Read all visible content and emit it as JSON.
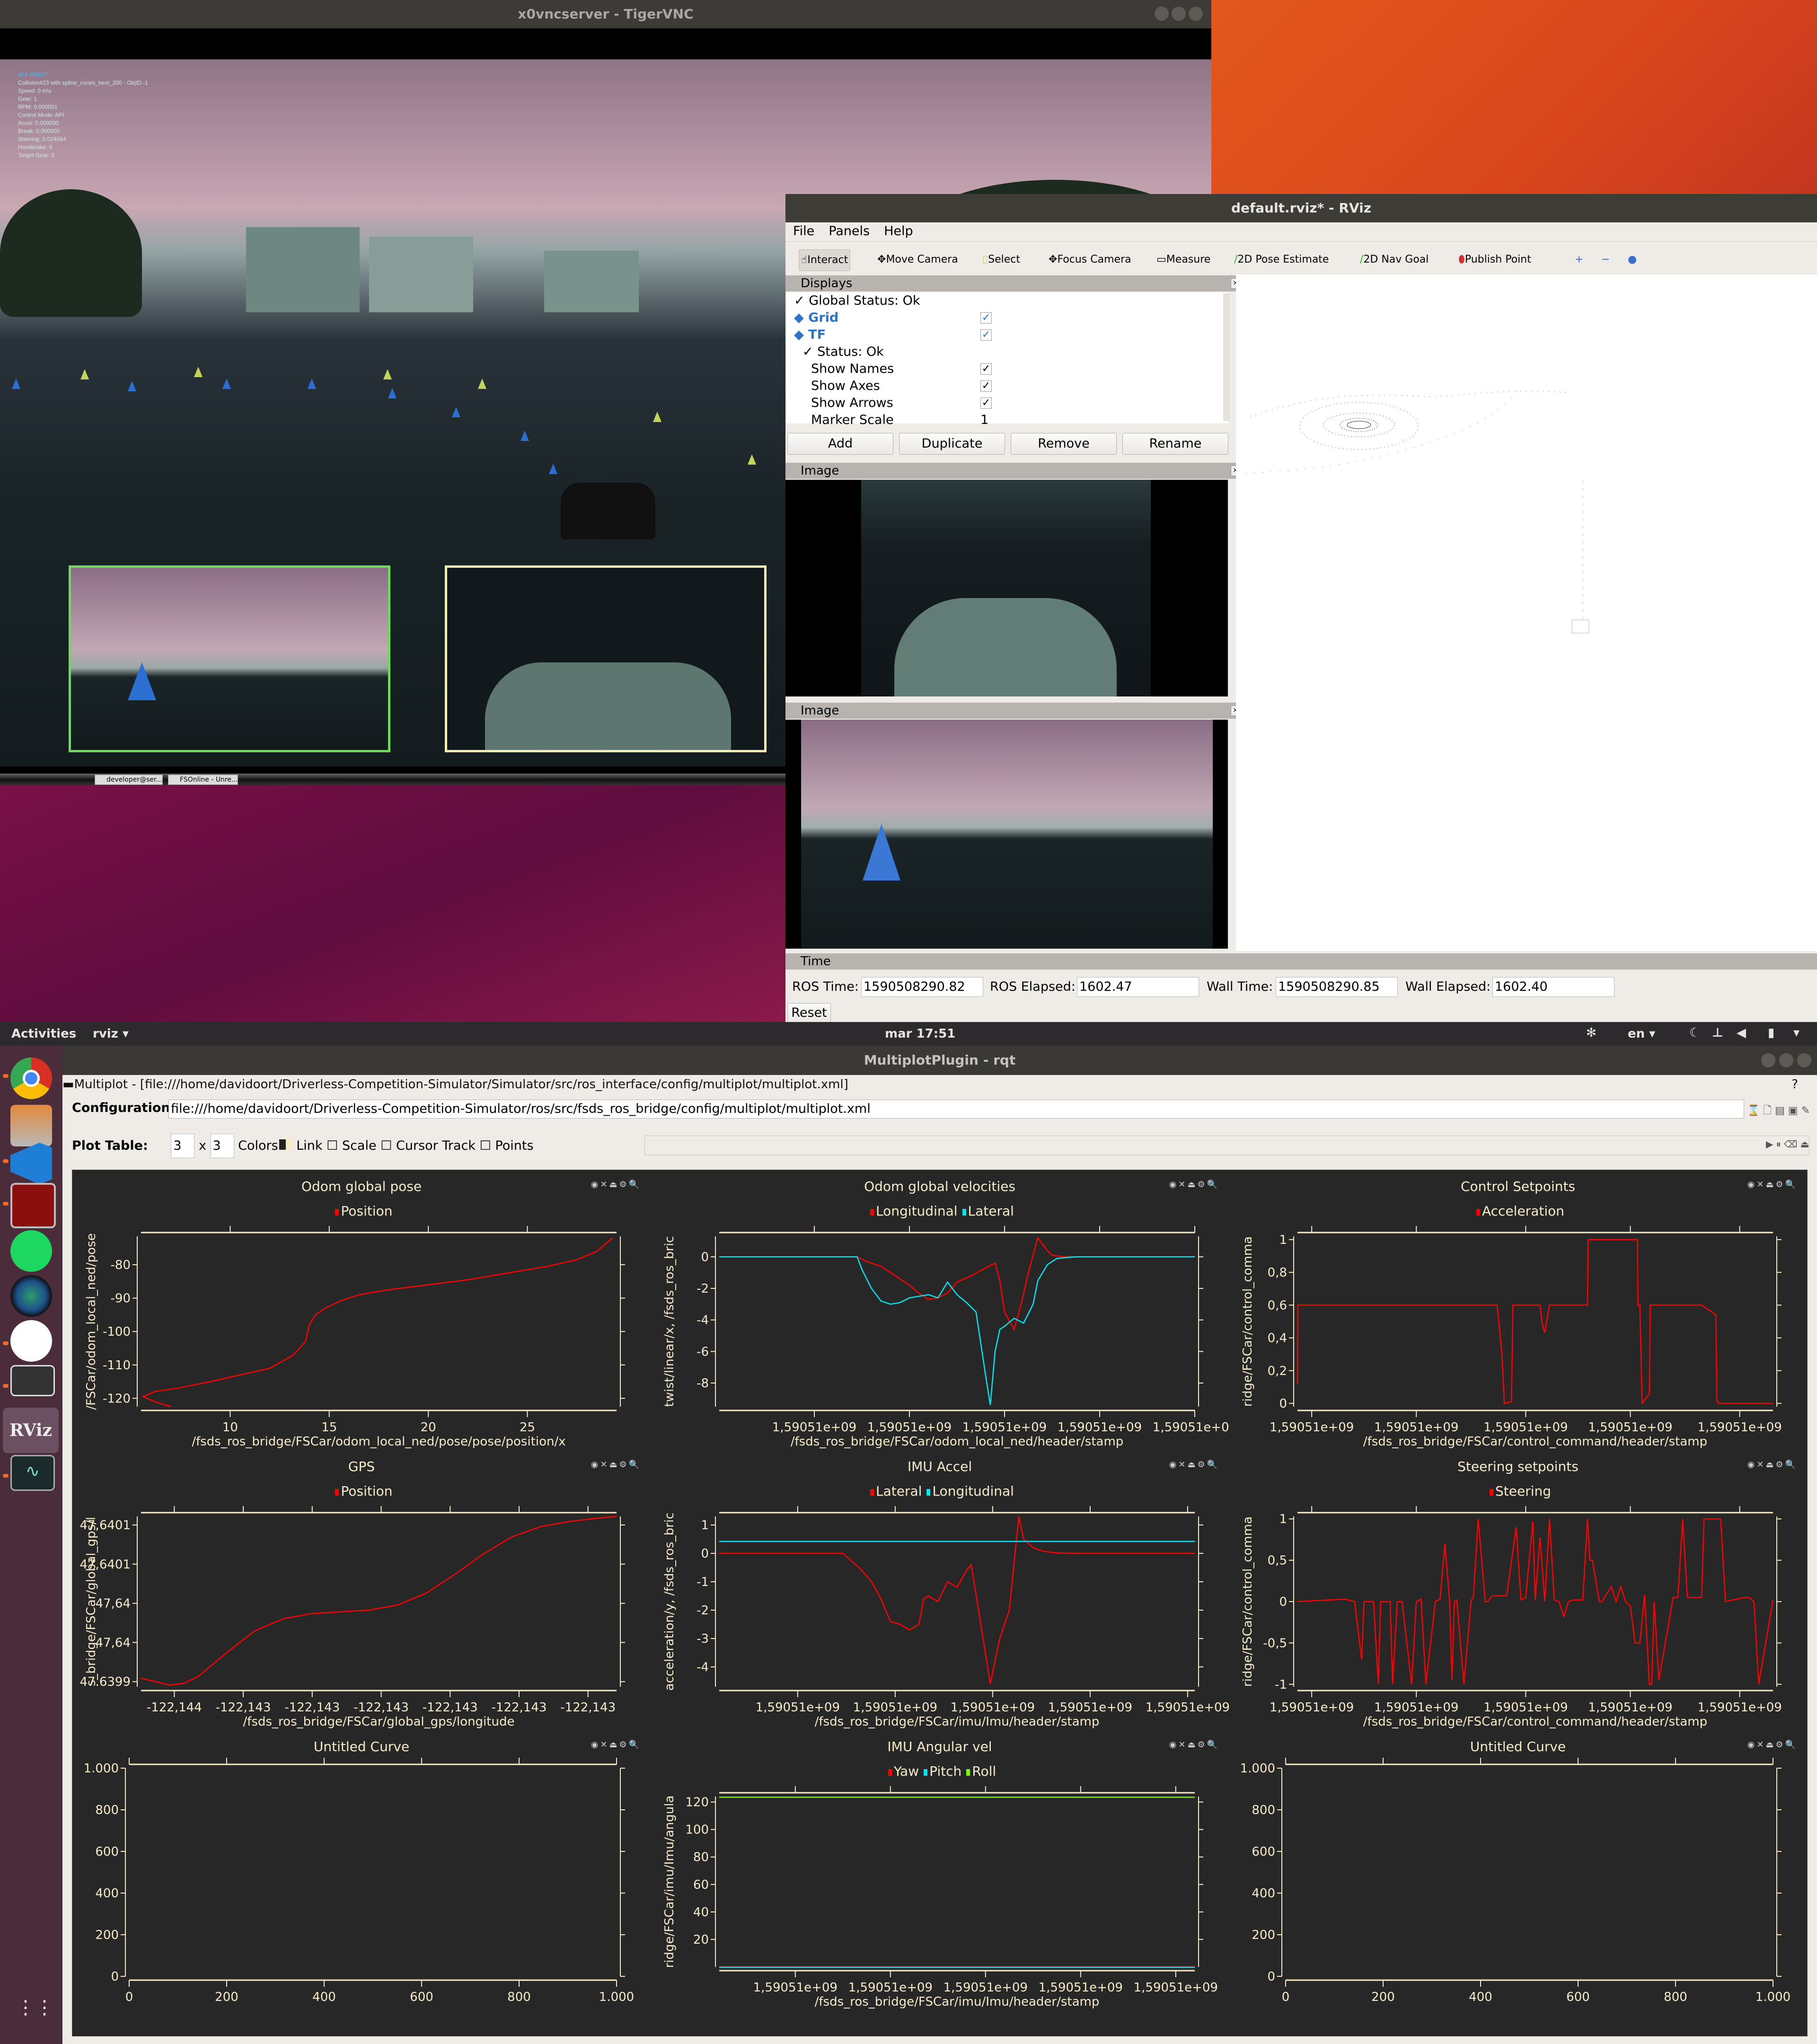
{
  "vnc": {
    "title": "x0vncserver - TigerVNC",
    "hud": [
      "424.485077",
      "Collision#23 with spline_cones_best_200 - ObjID -1",
      "Speed: 0 m\\s",
      "Gear: 1",
      "RPM: 0.000001",
      "Control Mode: API",
      "Accel: 0.000000",
      "Break: 0.000000",
      "Steering: 0.024564",
      "Handbrake: 0",
      "Target Gear: 0"
    ],
    "taskbar": [
      "developer@ser...",
      "FSOnline - Unre..."
    ]
  },
  "rviz": {
    "title": "default.rviz* - RViz",
    "menu": [
      "File",
      "Panels",
      "Help"
    ],
    "tools": [
      "Interact",
      "Move Camera",
      "Select",
      "Focus Camera",
      "Measure",
      "2D Pose Estimate",
      "2D Nav Goal",
      "Publish Point"
    ],
    "tool_icons": [
      "hand-icon",
      "move-camera-icon",
      "select-icon",
      "focus-camera-icon",
      "measure-icon",
      "pose-estimate-icon",
      "nav-goal-icon",
      "publish-point-icon"
    ],
    "displays_title": "Displays",
    "displays": [
      {
        "label": "Global Status: Ok",
        "checked": null,
        "indent": 0,
        "blue": false
      },
      {
        "label": "Grid",
        "checked": true,
        "indent": 0,
        "blue": true
      },
      {
        "label": "TF",
        "checked": true,
        "indent": 0,
        "blue": true
      },
      {
        "label": "Status: Ok",
        "checked": null,
        "indent": 1,
        "blue": false
      },
      {
        "label": "Show Names",
        "checked": true,
        "indent": 2,
        "blue": false
      },
      {
        "label": "Show Axes",
        "checked": true,
        "indent": 2,
        "blue": false
      },
      {
        "label": "Show Arrows",
        "checked": true,
        "indent": 2,
        "blue": false
      },
      {
        "label": "Marker Scale",
        "value": "1",
        "indent": 2,
        "blue": false
      }
    ],
    "buttons": [
      "Add",
      "Duplicate",
      "Remove",
      "Rename"
    ],
    "image_panel_1": "Image",
    "image_panel_2": "Image",
    "time_panel": "Time",
    "time": {
      "ros_time_label": "ROS Time:",
      "ros_time": "1590508290.82",
      "ros_elapsed_label": "ROS Elapsed:",
      "ros_elapsed": "1602.47",
      "wall_time_label": "Wall Time:",
      "wall_time": "1590508290.85",
      "wall_elapsed_label": "Wall Elapsed:",
      "wall_elapsed": "1602.40",
      "reset": "Reset"
    }
  },
  "topbar": {
    "activities": "Activities",
    "app": "rviz",
    "clock": "mar 17:51",
    "lang": "en"
  },
  "dock": [
    "chrome",
    "files",
    "vscode",
    "terminator",
    "spotify",
    "camera",
    "slack",
    "no-entry-app",
    "rviz",
    "system-monitor"
  ],
  "rqt": {
    "title": "MultiplotPlugin - rqt",
    "header": "Multiplot - [file:///home/davidoort/Driverless-Competition-Simulator/Simulator/src/ros_interface/config/multiplot/multiplot.xml]",
    "config_label": "Configuration:",
    "config_value": "file:///home/davidoort/Driverless-Competition-Simulator/ros/src/fsds_ros_bridge/config/multiplot/multiplot.xml",
    "plot_table_label": "Plot Table:",
    "rows": "3",
    "cols": "3",
    "x_sep": "x",
    "options": [
      "Colors",
      "Link",
      "Scale",
      "Cursor",
      "Track",
      "Points"
    ]
  },
  "chart_data": [
    {
      "type": "line",
      "title": "Odom global pose",
      "legend": [
        "Position"
      ],
      "colors": [
        "#ff0000"
      ],
      "xlabel": "/fsds_ros_bridge/FSCar/odom_local_ned/pose/pose/position/x",
      "ylabel": "/FSCar/odom_local_ned/pose",
      "xlim": [
        5.5,
        29.5
      ],
      "ylim": [
        -122.5,
        -71.5
      ],
      "xticks": [
        "10",
        "15",
        "20",
        "25"
      ],
      "xtickvals": [
        10,
        15,
        20,
        25
      ],
      "yticks": [
        "-80",
        "-90",
        "-100",
        "-110",
        "-120"
      ],
      "ytickvals": [
        -80,
        -90,
        -100,
        -110,
        -120
      ],
      "series": [
        {
          "name": "Position",
          "x": [
            7,
            6.2,
            5.6,
            6.2,
            7.5,
            9,
            10.5,
            12,
            13.2,
            13.8,
            14,
            14.3,
            14.8,
            15.5,
            16.5,
            18,
            20,
            22,
            24,
            26,
            27.5,
            28.5,
            29.3
          ],
          "y": [
            -122.5,
            -121,
            -119.5,
            -118,
            -116.8,
            -115,
            -113,
            -111,
            -107,
            -103,
            -98,
            -95,
            -93,
            -91,
            -89,
            -87.5,
            -86,
            -84.5,
            -82.5,
            -80.5,
            -78.5,
            -76,
            -72
          ]
        }
      ]
    },
    {
      "type": "line",
      "title": "Odom global velocities",
      "legend": [
        "Longitudinal",
        "Lateral"
      ],
      "colors": [
        "#ff0000",
        "#00e5f0"
      ],
      "xlabel": "/fsds_ros_bridge/FSCar/odom_local_ned/header/stamp",
      "ylabel": "twist/linear/x, /fsds_ros_bric",
      "xlim": [
        0,
        100
      ],
      "ylim": [
        -9.5,
        1.3
      ],
      "xticks": [
        "1,59051e+09",
        "1,59051e+09",
        "1,59051e+09",
        "1,59051e+09",
        "1,59051e+09"
      ],
      "xtickvals": [
        20,
        40,
        60,
        80,
        100
      ],
      "yticks": [
        "0",
        "-2",
        "-4",
        "-6",
        "-8"
      ],
      "ytickvals": [
        0,
        -2,
        -4,
        -6,
        -8
      ],
      "series": [
        {
          "name": "Longitudinal",
          "x": [
            0,
            29,
            31,
            34,
            37,
            40,
            42,
            44,
            46,
            48,
            50,
            53,
            56,
            58,
            59,
            60,
            62,
            63.5,
            65,
            67,
            69,
            70,
            72,
            75,
            76
          ],
          "y": [
            0,
            0,
            -0.3,
            -0.6,
            -1.2,
            -1.8,
            -2.3,
            -2.7,
            -2.6,
            -2.3,
            -1.6,
            -1.2,
            -0.7,
            -0.4,
            -1.5,
            -3.5,
            -4.6,
            -3,
            -1,
            1.2,
            0.4,
            0.1,
            0.02,
            0,
            0
          ]
        },
        {
          "name": "Lateral",
          "x": [
            0,
            29,
            30,
            32,
            34,
            36,
            38,
            40,
            42,
            44,
            46,
            48,
            50,
            52,
            54,
            56,
            57,
            58,
            59,
            60,
            62,
            64,
            66,
            67,
            69,
            71,
            74,
            76,
            100
          ],
          "y": [
            0,
            0,
            -0.8,
            -2,
            -2.8,
            -3,
            -2.9,
            -2.6,
            -2.5,
            -2.4,
            -2.6,
            -1.6,
            -2.4,
            -2.9,
            -3.5,
            -7.5,
            -9.4,
            -6,
            -4.6,
            -4.4,
            -3.9,
            -4.2,
            -3,
            -1.5,
            -0.5,
            -0.1,
            -0.02,
            0,
            0
          ]
        }
      ]
    },
    {
      "type": "line",
      "title": "Control Setpoints",
      "legend": [
        "Acceleration"
      ],
      "colors": [
        "#ff0000"
      ],
      "xlabel": "/fsds_ros_bridge/FSCar/control_command/header/stamp",
      "ylabel": "ridge/FSCar/control_comma",
      "xlim": [
        0,
        100
      ],
      "ylim": [
        -0.02,
        1.02
      ],
      "xticks": [
        "1,59051e+09",
        "1,59051e+09",
        "1,59051e+09",
        "1,59051e+09",
        "1,59051e+09"
      ],
      "xtickvals": [
        3,
        25,
        48,
        70,
        93
      ],
      "yticks": [
        "1",
        "0,8",
        "0,6",
        "0,4",
        "0,2",
        "0"
      ],
      "ytickvals": [
        1,
        0.8,
        0.6,
        0.4,
        0.2,
        0
      ],
      "series": [
        {
          "name": "Acceleration",
          "x": [
            0,
            0.1,
            42,
            43,
            43.5,
            45,
            45.3,
            51,
            51.5,
            52,
            53,
            61,
            61.1,
            71.5,
            71.6,
            72,
            72.5,
            74,
            74.2,
            85,
            88,
            88.2,
            88.5,
            100
          ],
          "y": [
            0.12,
            0.6,
            0.6,
            0.3,
            0,
            0.01,
            0.6,
            0.6,
            0.48,
            0.43,
            0.6,
            0.6,
            1,
            1,
            0.6,
            0.6,
            0,
            0.06,
            0.6,
            0.6,
            0.54,
            0.02,
            0,
            0
          ]
        }
      ]
    },
    {
      "type": "line",
      "title": "GPS",
      "legend": [
        "Position"
      ],
      "colors": [
        "#ff0000"
      ],
      "xlabel": "/fsds_ros_bridge/FSCar/global_gps/longitude",
      "ylabel": "s_bridge/FSCar/global_gps/l",
      "xlim": [
        0,
        100
      ],
      "ylim": [
        0,
        100
      ],
      "xticks": [
        "-122,144",
        "-122,143",
        "-122,143",
        "-122,143",
        "-122,143",
        "-122,143",
        "-122,143"
      ],
      "xtickvals": [
        7,
        21.5,
        36,
        50.5,
        65,
        79.5,
        94
      ],
      "yticks": [
        "47,6401",
        "47,6401",
        "47,64",
        "47,64",
        "47.6399"
      ],
      "ytickvals": [
        95,
        72,
        49,
        26,
        3
      ],
      "series": [
        {
          "name": "Position",
          "x": [
            0,
            3,
            6,
            9,
            12,
            18,
            24,
            30,
            36,
            42,
            48,
            54,
            60,
            66,
            72,
            78,
            84,
            90,
            96,
            100
          ],
          "y": [
            5,
            3,
            1,
            2,
            6,
            20,
            33,
            40,
            43,
            44,
            45,
            48,
            55,
            66,
            78,
            88,
            94,
            97,
            99,
            100
          ]
        }
      ]
    },
    {
      "type": "line",
      "title": "IMU Accel",
      "legend": [
        "Lateral",
        "Longitudinal"
      ],
      "colors": [
        "#ff0000",
        "#00e5f0"
      ],
      "xlabel": "/fsds_ros_bridge/FSCar/imu/Imu/header/stamp",
      "ylabel": "acceleration/y, /fsds_ros_bric",
      "xlim": [
        0,
        100
      ],
      "ylim": [
        -4.7,
        1.3
      ],
      "xticks": [
        "1,59051e+09",
        "1,59051e+09",
        "1,59051e+09",
        "1,59051e+09",
        "1,59051e+09"
      ],
      "xtickvals": [
        16.5,
        37,
        57.5,
        78,
        98.5
      ],
      "yticks": [
        "1",
        "0",
        "-1",
        "-2",
        "-3",
        "-4"
      ],
      "ytickvals": [
        1,
        0,
        -1,
        -2,
        -3,
        -4
      ],
      "series": [
        {
          "name": "Lateral",
          "x": [
            0,
            26,
            28,
            30,
            32,
            34,
            36,
            38,
            40,
            42,
            43,
            44,
            46,
            48,
            50,
            52,
            53,
            55,
            57,
            59,
            61,
            63,
            64,
            66,
            68,
            70,
            72,
            75,
            100
          ],
          "y": [
            0,
            0,
            -0.3,
            -0.6,
            -1,
            -1.6,
            -2.4,
            -2.5,
            -2.7,
            -2.5,
            -1.6,
            -1.5,
            -1.7,
            -1,
            -1.2,
            -0.6,
            -0.4,
            -2.5,
            -4.6,
            -3,
            -2,
            1.3,
            0.5,
            0.2,
            0.08,
            0.03,
            0.01,
            0,
            0
          ]
        },
        {
          "name": "Longitudinal",
          "x": [
            0,
            100
          ],
          "y": [
            0.42,
            0.42
          ]
        }
      ]
    },
    {
      "type": "line",
      "title": "Steering setpoints",
      "legend": [
        "Steering"
      ],
      "colors": [
        "#ff0000"
      ],
      "xlabel": "/fsds_ros_bridge/FSCar/control_command/header/stamp",
      "ylabel": "ridge/FSCar/control_comma",
      "xlim": [
        0,
        100
      ],
      "ylim": [
        -1.03,
        1.03
      ],
      "xticks": [
        "1,59051e+09",
        "1,59051e+09",
        "1,59051e+09",
        "1,59051e+09",
        "1,59051e+09"
      ],
      "xtickvals": [
        3,
        25,
        48,
        70,
        93
      ],
      "yticks": [
        "1",
        "0,5",
        "0",
        "-0,5",
        "-1"
      ],
      "ytickvals": [
        1,
        0.5,
        0,
        -0.5,
        -1
      ],
      "series": [
        {
          "name": "Steering",
          "x": [
            0,
            10,
            12,
            13.5,
            14,
            16,
            17,
            17.5,
            19.5,
            20,
            21,
            22,
            24,
            25,
            26,
            27,
            29,
            30,
            31,
            32,
            32.5,
            33,
            33.5,
            35,
            36.5,
            37,
            38,
            39.5,
            40,
            41,
            42,
            44,
            46,
            47,
            48,
            49.5,
            50,
            51,
            52,
            53,
            54,
            55,
            56,
            57,
            58,
            60,
            61,
            61.5,
            62,
            63.5,
            64,
            66,
            67,
            68,
            69,
            70,
            71,
            72,
            73,
            74,
            74.5,
            75,
            76,
            79,
            80,
            81,
            82,
            85,
            85.5,
            89,
            90,
            94,
            95,
            96,
            97,
            100
          ],
          "y": [
            0,
            0.03,
            0,
            -0.7,
            0,
            0,
            -1,
            0,
            0,
            -1,
            0,
            0,
            -1,
            0,
            0.03,
            -1,
            0,
            0.03,
            0.7,
            0,
            -0.95,
            0,
            0.02,
            -1,
            0,
            0.07,
            1,
            0,
            0,
            0.07,
            0.07,
            0.07,
            0.9,
            0.02,
            0.05,
            0.97,
            0.02,
            0.78,
            0,
            1,
            0.02,
            0,
            -0.18,
            0,
            0.02,
            0.02,
            1,
            0.5,
            0.5,
            0,
            0,
            0.18,
            0,
            0.18,
            0,
            -0.05,
            -0.5,
            -0.5,
            0.08,
            -1,
            -1,
            0,
            -0.95,
            0.05,
            0.05,
            1,
            0.05,
            0.05,
            1,
            1,
            0,
            0.05,
            0.05,
            0,
            -1,
            0.02,
            0.02
          ]
        }
      ]
    },
    {
      "type": "line",
      "title": "Untitled Curve",
      "legend": [],
      "colors": [],
      "xlabel": "",
      "ylabel": "",
      "xlim": [
        0,
        1000
      ],
      "ylim": [
        0,
        1000
      ],
      "xticks": [
        "0",
        "200",
        "400",
        "600",
        "800",
        "1.000"
      ],
      "xtickvals": [
        0,
        200,
        400,
        600,
        800,
        1000
      ],
      "yticks": [
        "1.000",
        "800",
        "600",
        "400",
        "200",
        "0"
      ],
      "ytickvals": [
        1000,
        800,
        600,
        400,
        200,
        0
      ],
      "series": []
    },
    {
      "type": "line",
      "title": "IMU Angular vel",
      "legend": [
        "Yaw",
        "Pitch",
        "Roll"
      ],
      "colors": [
        "#ff0000",
        "#00e5f0",
        "#7cfc00"
      ],
      "xlabel": "/fsds_ros_bridge/FSCar/imu/Imu/header/stamp",
      "ylabel": "ridge/FSCar/imu/Imu/angula",
      "xlim": [
        0,
        100
      ],
      "ylim": [
        0,
        124
      ],
      "xticks": [
        "1,59051e+09",
        "1,59051e+09",
        "1,59051e+09",
        "1,59051e+09",
        "1,59051e+09"
      ],
      "xtickvals": [
        16,
        36,
        56,
        76,
        96
      ],
      "yticks": [
        "120",
        "100",
        "80",
        "60",
        "40",
        "20"
      ],
      "ytickvals": [
        120,
        100,
        80,
        60,
        40,
        20
      ],
      "series": [
        {
          "name": "Yaw",
          "x": [
            0,
            100
          ],
          "y": [
            0.1,
            0.1
          ]
        },
        {
          "name": "Pitch",
          "x": [
            0,
            100
          ],
          "y": [
            -0.3,
            -0.3
          ]
        },
        {
          "name": "Roll",
          "x": [
            0,
            100
          ],
          "y": [
            123.5,
            123.5
          ]
        }
      ]
    },
    {
      "type": "line",
      "title": "Untitled Curve",
      "legend": [],
      "colors": [],
      "xlabel": "",
      "ylabel": "",
      "xlim": [
        0,
        1000
      ],
      "ylim": [
        0,
        1000
      ],
      "xticks": [
        "0",
        "200",
        "400",
        "600",
        "800",
        "1.000"
      ],
      "xtickvals": [
        0,
        200,
        400,
        600,
        800,
        1000
      ],
      "yticks": [
        "1.000",
        "800",
        "600",
        "400",
        "200",
        "0"
      ],
      "ytickvals": [
        1000,
        800,
        600,
        400,
        200,
        0
      ],
      "series": []
    }
  ]
}
